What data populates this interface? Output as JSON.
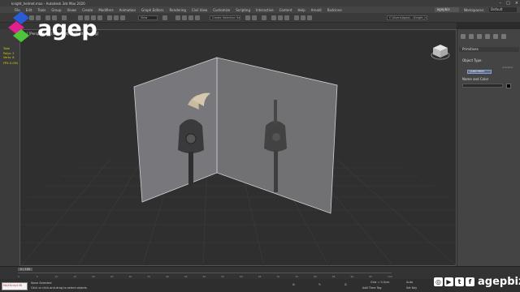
{
  "window": {
    "title": "knight_helmet.max - Autodesk 3ds Max 2020"
  },
  "menu": {
    "items": [
      "File",
      "Edit",
      "Tools",
      "Group",
      "Views",
      "Create",
      "Modifiers",
      "Animation",
      "Graph Editors",
      "Rendering",
      "Civil View",
      "Customize",
      "Scripting",
      "Interactive",
      "Content",
      "Help",
      "Arnold",
      "Railclone"
    ],
    "user": "agepbiz",
    "workspaces_label": "Workspaces:",
    "workspace_value": "Default"
  },
  "toolbar": {
    "view_combo": "View",
    "selection_set_combo": "Create Selection Set",
    "path_combo": "C:\\Users\\Agep\\...\\Knight_helmet\\"
  },
  "viewport": {
    "label": "[+] [Perspective] [Standard] [Default Shading]",
    "stats_label": "Total",
    "stats_rows": [
      "Polys:  2",
      "Verts:  8"
    ],
    "fps_label": "FPS:",
    "fps_value": "0.094"
  },
  "command_panel": {
    "category": "Primitives",
    "object_type_label": "Object Type",
    "autogrid": "AutoGrid",
    "active_button": "Quad Patch",
    "name_color_label": "Name and Color"
  },
  "timeline": {
    "slider": "0 / 100",
    "ticks": [
      "0",
      "5",
      "10",
      "15",
      "20",
      "25",
      "30",
      "35",
      "40",
      "45",
      "50",
      "55",
      "60",
      "65",
      "70",
      "75",
      "80",
      "85",
      "90",
      "95",
      "100"
    ]
  },
  "status": {
    "maxscript": "MAXScript Mi",
    "line1": "None Selected",
    "line2": "Click or click-and-drag to select objects",
    "x": "X:",
    "y": "Y:",
    "z": "Z:",
    "grid": "Grid = 0.0cm",
    "add_time_tag": "Add Time Tag",
    "auto_key": "Auto",
    "set_key": "Set Key"
  },
  "branding": {
    "logo_text": "agep",
    "social_icons": [
      "instagram-icon",
      "youtube-icon",
      "twitter-icon",
      "facebook-icon"
    ],
    "handle": "agepbiz",
    "colors": {
      "logo_blue": "#2a5bd7",
      "logo_magenta": "#e0208c",
      "logo_green": "#4ec43a"
    }
  }
}
